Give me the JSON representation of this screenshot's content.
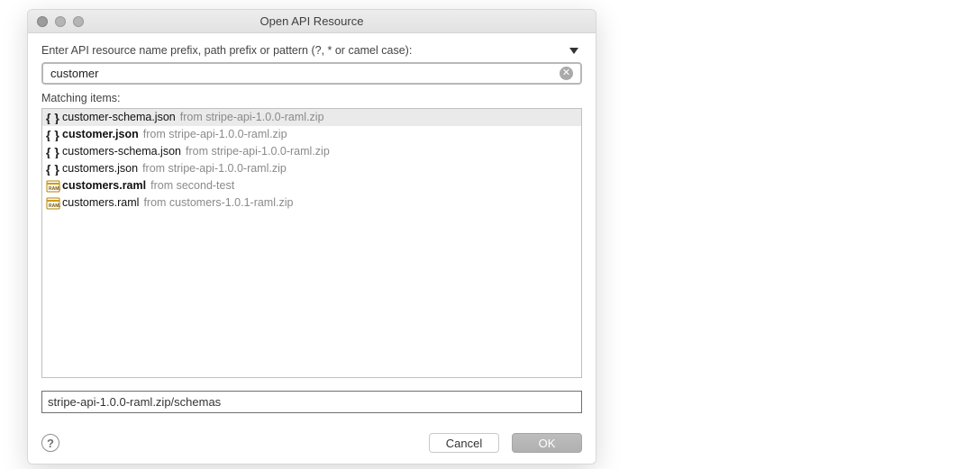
{
  "window": {
    "title": "Open API Resource"
  },
  "prompt": "Enter API resource name prefix, path prefix or pattern (?, * or camel case):",
  "search": {
    "value": "customer"
  },
  "matching_label": "Matching items:",
  "items": [
    {
      "icon": "braces",
      "name": "customer-schema.json",
      "from": "from stripe-api-1.0.0-raml.zip",
      "bold": false,
      "selected": true
    },
    {
      "icon": "braces",
      "name": "customer.json",
      "from": "from stripe-api-1.0.0-raml.zip",
      "bold": true,
      "selected": false
    },
    {
      "icon": "braces",
      "name": "customers-schema.json",
      "from": "from stripe-api-1.0.0-raml.zip",
      "bold": false,
      "selected": false
    },
    {
      "icon": "braces",
      "name": "customers.json",
      "from": "from stripe-api-1.0.0-raml.zip",
      "bold": false,
      "selected": false
    },
    {
      "icon": "raml",
      "name": "customers.raml",
      "from": "from second-test",
      "bold": true,
      "selected": false
    },
    {
      "icon": "raml",
      "name": "customers.raml",
      "from": "from customers-1.0.1-raml.zip",
      "bold": false,
      "selected": false
    }
  ],
  "path": "stripe-api-1.0.0-raml.zip/schemas",
  "buttons": {
    "cancel": "Cancel",
    "ok": "OK"
  },
  "help": "?"
}
